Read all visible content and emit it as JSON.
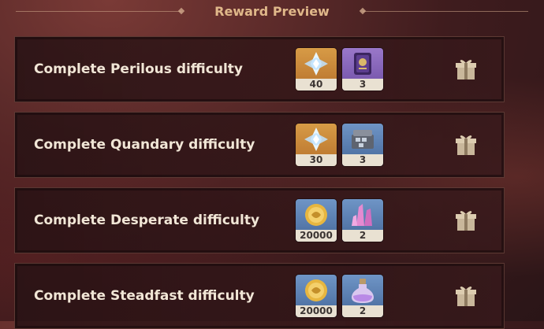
{
  "header": {
    "title": "Reward Preview"
  },
  "rows": [
    {
      "label": "Complete Perilous difficulty",
      "rewards": [
        {
          "icon": "primogem-icon",
          "qty": "40",
          "bg": "orange"
        },
        {
          "icon": "heros-wit-book-icon",
          "qty": "3",
          "bg": "purple"
        }
      ]
    },
    {
      "label": "Complete Quandary difficulty",
      "rewards": [
        {
          "icon": "primogem-icon",
          "qty": "30",
          "bg": "orange"
        },
        {
          "icon": "mystic-enhancement-ore-icon",
          "qty": "3",
          "bg": "blue"
        }
      ]
    },
    {
      "label": "Complete Desperate difficulty",
      "rewards": [
        {
          "icon": "mora-icon",
          "qty": "20000",
          "bg": "blue"
        },
        {
          "icon": "crystal-chunk-icon",
          "qty": "2",
          "bg": "blue"
        }
      ]
    },
    {
      "label": "Complete Steadfast difficulty",
      "rewards": [
        {
          "icon": "mora-icon",
          "qty": "20000",
          "bg": "blue"
        },
        {
          "icon": "potion-icon",
          "qty": "2",
          "bg": "blue"
        }
      ]
    }
  ],
  "gift_icon": "gift-icon"
}
